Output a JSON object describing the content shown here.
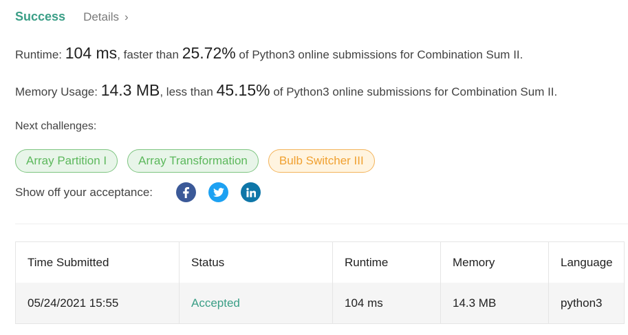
{
  "header": {
    "status": "Success",
    "details_label": "Details",
    "details_chevron": "›"
  },
  "stats": {
    "runtime_label": "Runtime: ",
    "runtime_value": "104 ms",
    "runtime_mid": ", faster than ",
    "runtime_percent": "25.72%",
    "runtime_tail": " of Python3 online submissions for Combination Sum II.",
    "memory_label": "Memory Usage: ",
    "memory_value": "14.3 MB",
    "memory_mid": ", less than ",
    "memory_percent": "45.15%",
    "memory_tail": " of Python3 online submissions for Combination Sum II."
  },
  "next_challenges": {
    "label": "Next challenges:",
    "items": [
      {
        "label": "Array Partition I",
        "difficulty": "easy"
      },
      {
        "label": "Array Transformation",
        "difficulty": "easy"
      },
      {
        "label": "Bulb Switcher III",
        "difficulty": "medium"
      }
    ]
  },
  "share": {
    "label": "Show off your acceptance:",
    "icons": [
      "facebook-icon",
      "twitter-icon",
      "linkedin-icon"
    ]
  },
  "table": {
    "headers": [
      "Time Submitted",
      "Status",
      "Runtime",
      "Memory",
      "Language"
    ],
    "rows": [
      [
        "05/24/2021 15:55",
        "Accepted",
        "104 ms",
        "14.3 MB",
        "python3"
      ]
    ]
  },
  "colors": {
    "success": "#3a9e86",
    "easy": "#5cb85c",
    "medium": "#f0a030",
    "facebook": "#3b5998",
    "twitter": "#1da1f2",
    "linkedin": "#0e76a8"
  }
}
